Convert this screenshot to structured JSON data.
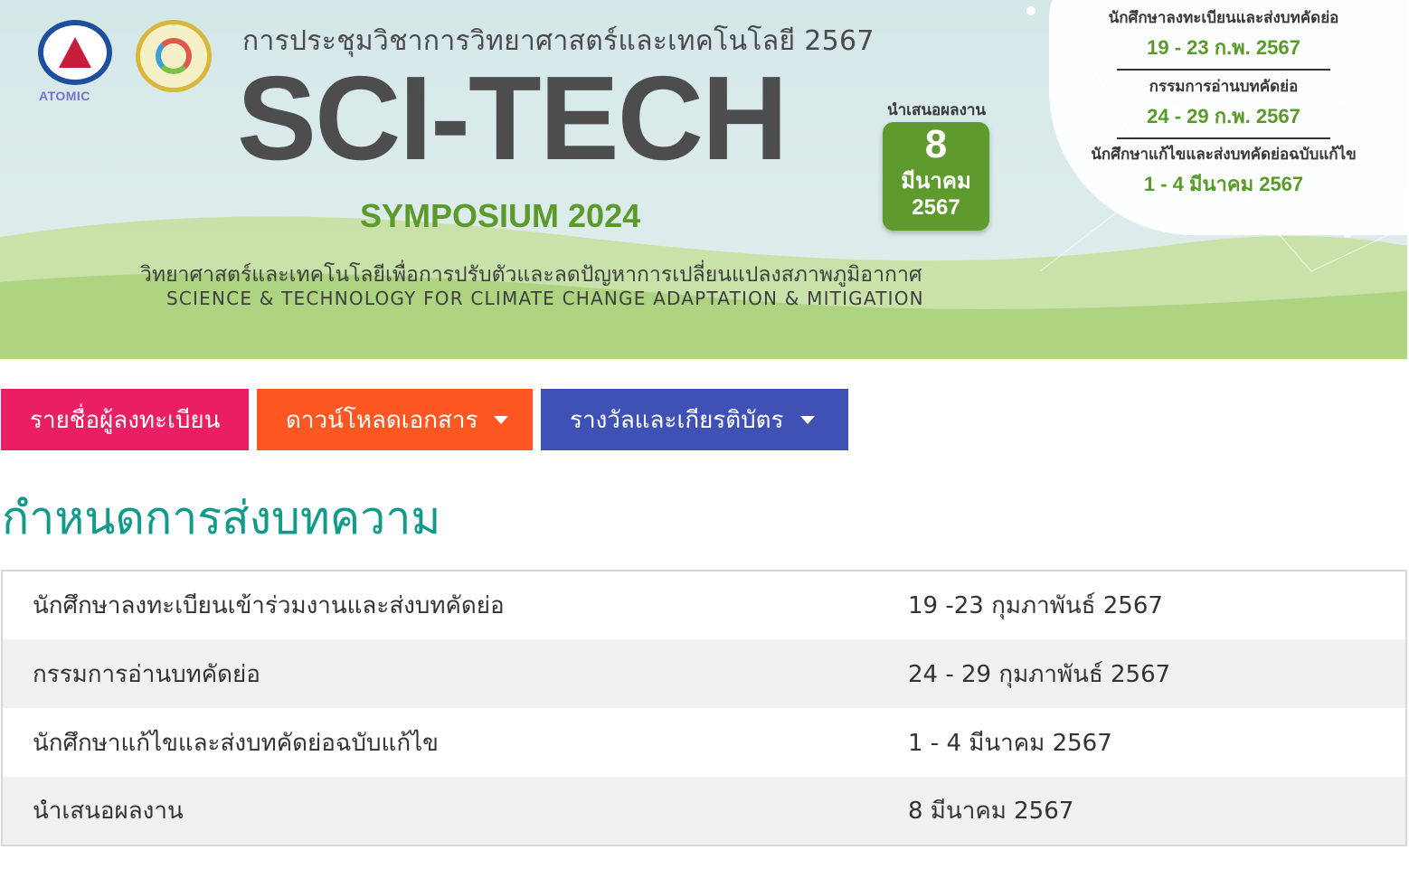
{
  "banner": {
    "logo_text": "ATOMIC",
    "title_th": "การประชุมวิชาการวิทยาศาสตร์และเทคโนโลยี 2567",
    "title_main": "SCI-TECH",
    "subtitle": "SYMPOSIUM 2024",
    "tagline_th": "วิทยาศาสตร์และเทคโนโลยีเพื่อการปรับตัวและลดปัญหาการเปลี่ยนแปลงสภาพภูมิอากาศ",
    "tagline_en": "SCIENCE & TECHNOLOGY FOR CLIMATE CHANGE ADAPTATION & MITIGATION",
    "present": {
      "label": "นำเสนอผลงาน",
      "day": "8",
      "month": "มีนาคม",
      "year": "2567"
    },
    "schedule": [
      {
        "label": "นักศึกษาลงทะเบียนและส่งบทคัดย่อ",
        "date": "19 - 23 ก.พ. 2567"
      },
      {
        "label": "กรรมการอ่านบทคัดย่อ",
        "date": "24 - 29 ก.พ. 2567"
      },
      {
        "label": "นักศึกษาแก้ไขและส่งบทคัดย่อฉบับแก้ไข",
        "date": "1 - 4 มีนาคม 2567"
      }
    ],
    "colors": {
      "accent_green": "#5f9a2f",
      "title_gray": "#4d4d4d"
    }
  },
  "nav": {
    "register_label": "รายชื่อผู้ลงทะเบียน",
    "download_label": "ดาวน์โหลดเอกสาร",
    "awards_label": "รางวัลและเกียรติบัตร",
    "colors": {
      "register": "#e91e63",
      "download": "#ff5722",
      "awards": "#3f51b5"
    }
  },
  "section": {
    "title": "กำหนดการส่งบทความ",
    "title_color": "#129b8a"
  },
  "table": {
    "rows": [
      {
        "item": "นักศึกษาลงทะเบียนเข้าร่วมงานและส่งบทคัดย่อ",
        "date": "19 -23 กุมภาพันธ์ 2567"
      },
      {
        "item": "กรรมการอ่านบทคัดย่อ",
        "date": "24 - 29 กุมภาพันธ์ 2567"
      },
      {
        "item": "นักศึกษาแก้ไขและส่งบทคัดย่อฉบับแก้ไข",
        "date": "1 - 4 มีนาคม 2567"
      },
      {
        "item": "นำเสนอผลงาน",
        "date": "8 มีนาคม 2567"
      }
    ]
  }
}
